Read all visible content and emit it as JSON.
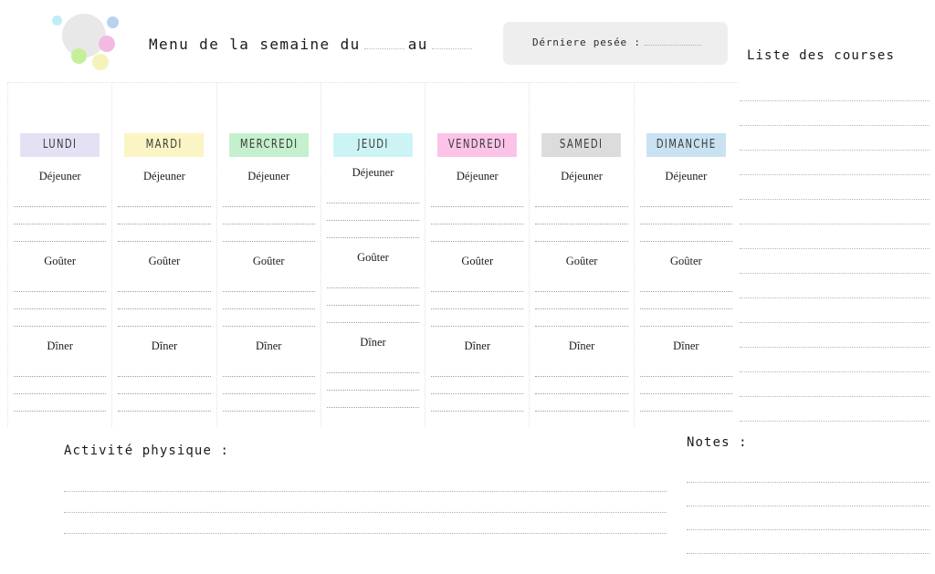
{
  "header": {
    "title_prefix": "Menu de la semaine du",
    "title_middle": "au",
    "weigh_label": "Dérniere pesée :",
    "bubbles": [
      {
        "name": "bubble-gray",
        "color": "#e8e8e8"
      },
      {
        "name": "bubble-cyan",
        "color": "#bdeef5"
      },
      {
        "name": "bubble-blue",
        "color": "#b6d3ee"
      },
      {
        "name": "bubble-pink",
        "color": "#f4b9e3"
      },
      {
        "name": "bubble-green",
        "color": "#c4f09a"
      },
      {
        "name": "bubble-yellow",
        "color": "#f5f3bb"
      }
    ]
  },
  "shopping": {
    "title": "Liste des courses",
    "line_count": 14
  },
  "week": {
    "meals": [
      "Déjeuner",
      "Goûter",
      "Dîner"
    ],
    "lines_per_meal": 3,
    "days": [
      {
        "label": "LUNDI",
        "color": "#e4e1f5"
      },
      {
        "label": "MARDI",
        "color": "#fbf4c4"
      },
      {
        "label": "MERCREDI",
        "color": "#c4f0cd"
      },
      {
        "label": "JEUDI",
        "color": "#cdf4f4"
      },
      {
        "label": "VENDREDI",
        "color": "#fbc3e8"
      },
      {
        "label": "SAMEDI",
        "color": "#dcdcdc"
      },
      {
        "label": "DIMANCHE",
        "color": "#c9e2f2"
      }
    ]
  },
  "activity": {
    "title": "Activité physique :",
    "line_count": 3
  },
  "notes": {
    "title": "Notes :",
    "line_count": 4
  }
}
